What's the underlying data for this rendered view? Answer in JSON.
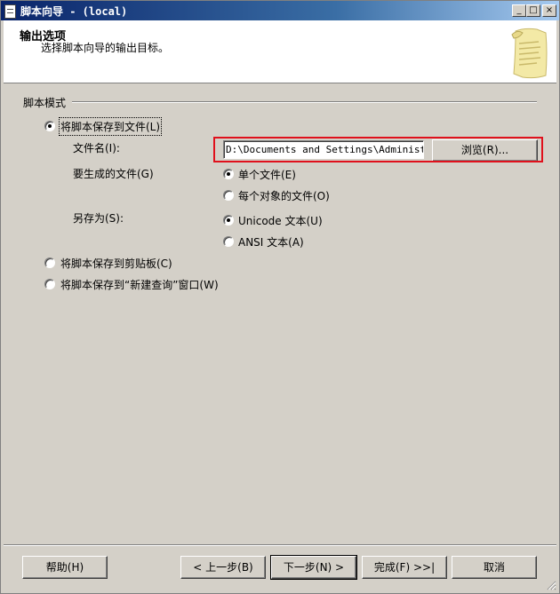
{
  "window": {
    "title": "脚本向导 - (local)",
    "controls": {
      "minimize": "_",
      "maximize": "□",
      "close": "×"
    }
  },
  "header": {
    "title": "输出选项",
    "subtitle": "选择脚本向导的输出目标。"
  },
  "script_mode": {
    "group_label": "脚本模式",
    "save_to_file": {
      "label": "将脚本保存到文件(L)",
      "selected": true,
      "file_name": {
        "label": "文件名(I):",
        "value": "D:\\Documents and Settings\\Administrat"
      },
      "browse_label": "浏览(R)...",
      "files_to_generate": {
        "label": "要生成的文件(G)",
        "options": [
          {
            "label": "单个文件(E)",
            "selected": true
          },
          {
            "label": "每个对象的文件(O)",
            "selected": false
          }
        ]
      },
      "save_as": {
        "label": "另存为(S):",
        "options": [
          {
            "label": "Unicode 文本(U)",
            "selected": true
          },
          {
            "label": "ANSI 文本(A)",
            "selected": false
          }
        ]
      }
    },
    "save_to_clipboard": {
      "label": "将脚本保存到剪贴板(C)",
      "selected": false
    },
    "save_to_new_query": {
      "label": "将脚本保存到“新建查询”窗口(W)",
      "selected": false
    }
  },
  "footer": {
    "help": "帮助(H)",
    "back": "< 上一步(B)",
    "next": "下一步(N) >",
    "finish": "完成(F) >>|",
    "cancel": "取消"
  },
  "colors": {
    "title_bar": "#0a246a",
    "highlight_box": "#e0101c",
    "dialog_bg": "#d4d0c8"
  }
}
